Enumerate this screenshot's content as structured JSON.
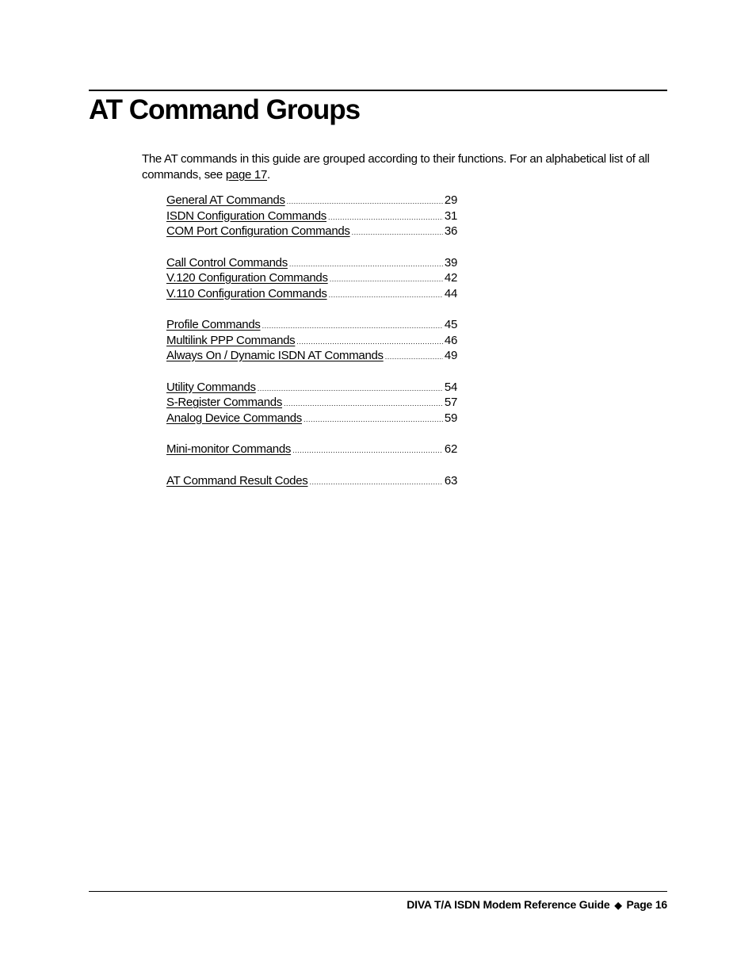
{
  "page": {
    "title": "AT Command Groups",
    "intro": {
      "text_before": "The AT commands in this guide are grouped according to their functions. For an alphabetical list of all commands, see ",
      "link_text": "page 17",
      "text_after": "."
    },
    "toc": {
      "groups": [
        {
          "entries": [
            {
              "label": "General AT Commands",
              "page": "29"
            },
            {
              "label": "ISDN Configuration Commands",
              "page": "31"
            },
            {
              "label": "COM Port Configuration Commands",
              "page": "36"
            }
          ]
        },
        {
          "entries": [
            {
              "label": "Call Control Commands",
              "page": "39"
            },
            {
              "label": "V.120 Configuration Commands",
              "page": "42"
            },
            {
              "label": "V.110 Configuration Commands",
              "page": "44"
            }
          ]
        },
        {
          "entries": [
            {
              "label": "Profile Commands",
              "page": "45"
            },
            {
              "label": "Multilink PPP Commands",
              "page": "46"
            },
            {
              "label": "Always On / Dynamic ISDN AT Commands",
              "page": "49"
            }
          ]
        },
        {
          "entries": [
            {
              "label": "Utility Commands",
              "page": "54"
            },
            {
              "label": "S-Register Commands",
              "page": "57"
            },
            {
              "label": "Analog Device Commands",
              "page": "59"
            }
          ]
        },
        {
          "entries": [
            {
              "label": "Mini-monitor Commands",
              "page": "62"
            }
          ]
        },
        {
          "entries": [
            {
              "label": "AT Command Result Codes",
              "page": "63"
            }
          ]
        }
      ]
    },
    "footer": {
      "doc_title": "DIVA T/A ISDN Modem Reference Guide",
      "separator_icon": "diamond-icon",
      "separator_glyph": "◆",
      "page_label": "Page 16"
    }
  }
}
